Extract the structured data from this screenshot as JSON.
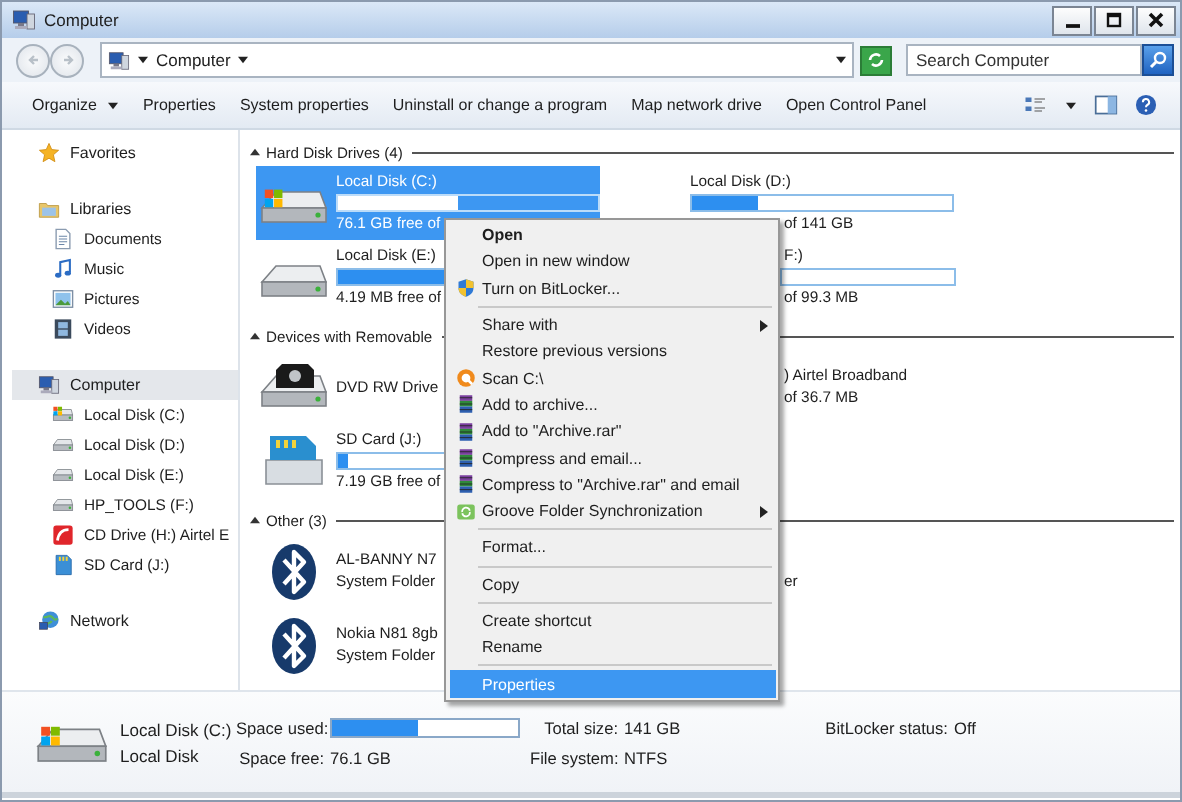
{
  "window": {
    "title": "Computer"
  },
  "address": {
    "path": "Computer",
    "search_placeholder": "Search Computer"
  },
  "toolbar": [
    {
      "label": "Organize",
      "dropdown": true
    },
    {
      "label": "Properties",
      "dropdown": false
    },
    {
      "label": "System properties",
      "dropdown": false
    },
    {
      "label": "Uninstall or change a program",
      "dropdown": false
    },
    {
      "label": "Map network drive",
      "dropdown": false
    },
    {
      "label": "Open Control Panel",
      "dropdown": false
    }
  ],
  "nav": [
    {
      "label": "Favorites",
      "kind": "star",
      "selected": false
    },
    {
      "label": "Libraries",
      "kind": "library",
      "selected": false,
      "children": [
        {
          "label": "Documents",
          "kind": "document",
          "selected": false
        },
        {
          "label": "Music",
          "kind": "music",
          "selected": false
        },
        {
          "label": "Pictures",
          "kind": "picture",
          "selected": false
        },
        {
          "label": "Videos",
          "kind": "video",
          "selected": false
        }
      ]
    },
    {
      "label": "Computer",
      "kind": "computer",
      "selected": true,
      "children": [
        {
          "label": "Local Disk (C:)",
          "kind": "sysdisk",
          "selected": false
        },
        {
          "label": "Local Disk (D:)",
          "kind": "disk",
          "selected": false
        },
        {
          "label": "Local Disk (E:)",
          "kind": "disk",
          "selected": false
        },
        {
          "label": "HP_TOOLS (F:)",
          "kind": "disk",
          "selected": false
        },
        {
          "label": "CD Drive (H:) Airtel E",
          "kind": "cd",
          "selected": false
        },
        {
          "label": "SD Card (J:)",
          "kind": "sd",
          "selected": false
        }
      ]
    },
    {
      "label": "Network",
      "kind": "network",
      "selected": false
    }
  ],
  "sections": [
    {
      "title": "Hard Disk Drives (4)",
      "expanded": true,
      "tiles": [
        {
          "kind": "sysdisk",
          "name": "Local Disk (C:)",
          "level": 0.46,
          "free": "76.1 GB free of",
          "selected": true
        },
        {
          "kind": "clipped",
          "name": "Local Disk (D:)",
          "level": 0.25,
          "free": "of 141 GB",
          "selected": false
        },
        {
          "kind": "disk",
          "name": "Local Disk (E:)",
          "level": 0.99,
          "free": "4.19 MB free of",
          "selected": false
        },
        {
          "kind": "fragment",
          "name": "F:)",
          "bar": true,
          "free": "of 99.3 MB",
          "selected": false
        }
      ]
    },
    {
      "title": "Devices with Removable",
      "expanded": true,
      "tiles": [
        {
          "kind": "dvd",
          "name": "DVD RW Drive",
          "selected": false
        },
        {
          "kind": "fragment",
          "name": ") Airtel Broadband",
          "free": "of 36.7 MB",
          "selected": false
        },
        {
          "kind": "sd",
          "name": "SD Card (J:)",
          "level": 0.04,
          "free": "7.19 GB free of",
          "selected": false
        }
      ]
    },
    {
      "title": "Other (3)",
      "expanded": true,
      "tiles": [
        {
          "kind": "bluetooth",
          "name": "AL-BANNY N7",
          "sub": "System Folder",
          "selected": false
        },
        {
          "kind": "fragment",
          "sub": "er",
          "selected": false
        },
        {
          "kind": "bluetooth",
          "name": "Nokia N81 8gb",
          "sub": "System Folder",
          "selected": false
        }
      ]
    }
  ],
  "context_menu": [
    {
      "kind": "item",
      "label": "Open",
      "bold": true,
      "submenu": false,
      "selected": false
    },
    {
      "kind": "item",
      "label": "Open in new window",
      "bold": false,
      "submenu": false,
      "selected": false
    },
    {
      "kind": "shield",
      "label": "Turn on BitLocker...",
      "bold": false,
      "submenu": false,
      "selected": false
    },
    {
      "kind": "separator"
    },
    {
      "kind": "item",
      "label": "Share with",
      "bold": false,
      "submenu": true,
      "selected": false
    },
    {
      "kind": "item",
      "label": "Restore previous versions",
      "bold": false,
      "submenu": false,
      "selected": false
    },
    {
      "kind": "scan",
      "label": "Scan C:\\",
      "bold": false,
      "submenu": false,
      "selected": false
    },
    {
      "kind": "archive",
      "label": "Add to archive...",
      "bold": false,
      "submenu": false,
      "selected": false
    },
    {
      "kind": "archive",
      "label": "Add to \"Archive.rar\"",
      "bold": false,
      "submenu": false,
      "selected": false
    },
    {
      "kind": "archive",
      "label": "Compress and email...",
      "bold": false,
      "submenu": false,
      "selected": false
    },
    {
      "kind": "archive",
      "label": "Compress to \"Archive.rar\" and email",
      "bold": false,
      "submenu": false,
      "selected": false
    },
    {
      "kind": "sync",
      "label": "Groove Folder Synchronization",
      "bold": false,
      "submenu": true,
      "selected": false
    },
    {
      "kind": "separator"
    },
    {
      "kind": "item",
      "label": "Format...",
      "bold": false,
      "submenu": false,
      "selected": false
    },
    {
      "kind": "separator"
    },
    {
      "kind": "item",
      "label": "Copy",
      "bold": false,
      "submenu": false,
      "selected": false
    },
    {
      "kind": "separator"
    },
    {
      "kind": "item",
      "label": "Create shortcut",
      "bold": false,
      "submenu": false,
      "selected": false
    },
    {
      "kind": "item",
      "label": "Rename",
      "bold": false,
      "submenu": false,
      "selected": false
    },
    {
      "kind": "separator"
    },
    {
      "kind": "item",
      "label": "Properties",
      "bold": false,
      "submenu": false,
      "selected": true
    }
  ],
  "details": {
    "name": "Local Disk (C:)",
    "type": "Local Disk",
    "space_used": {
      "label": "Space used:",
      "level": 0.46
    },
    "space_free": {
      "label": "Space free:",
      "value": "76.1 GB"
    },
    "total_size": {
      "label": "Total size:",
      "value": "141 GB"
    },
    "file_system": {
      "label": "File system:",
      "value": "NTFS"
    },
    "bitlocker": {
      "label": "BitLocker status:",
      "value": "Off"
    }
  }
}
